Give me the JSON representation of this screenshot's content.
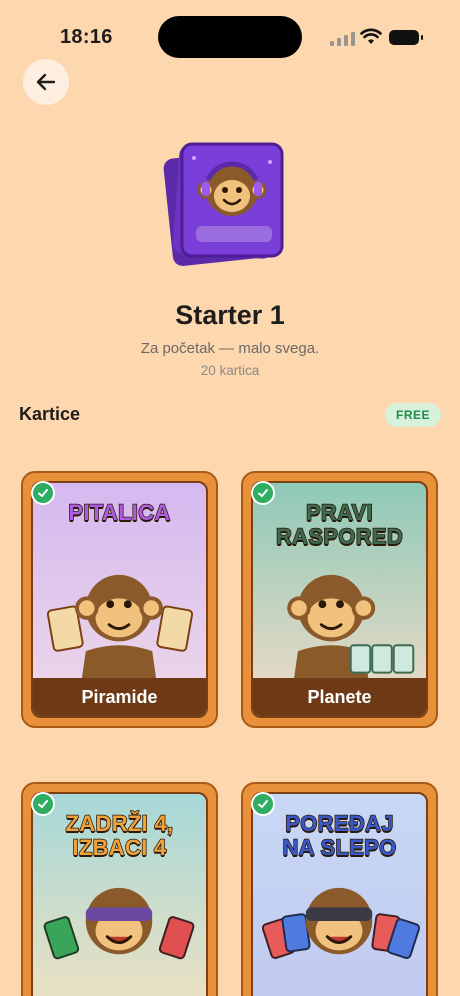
{
  "status_bar": {
    "time": "18:16"
  },
  "deck": {
    "title": "Starter 1",
    "subtitle": "Za početak — malo svega.",
    "count": "20 kartica"
  },
  "section": {
    "label": "Kartice",
    "badge": "FREE"
  },
  "cards": [
    {
      "title": "PITALICA",
      "footer": "Piramide",
      "title_color": "#b05ce0",
      "bg_top": "#d5b8f0",
      "bg_bottom": "#f0d9e8"
    },
    {
      "title": "PRAVI\nRASPORED",
      "footer": "Planete",
      "title_color": "#3f6a52",
      "bg_top": "#8fc9b8",
      "bg_bottom": "#f2dcc8"
    },
    {
      "title": "ZADRŽI 4,\nIZBACI 4",
      "footer": "",
      "title_color": "#f2a23a",
      "bg_top": "#a6d8d8",
      "bg_bottom": "#f3e2c0"
    },
    {
      "title": "POREĐAJ\nNA SLEPO",
      "footer": "",
      "title_color": "#3a58c8",
      "bg_top": "#c8d8f4",
      "bg_bottom": "#c0c8f0"
    }
  ],
  "colors": {
    "background": "#fdd7ad",
    "card_frame": "#e9913a",
    "check": "#2fae63"
  },
  "icons": {
    "back": "arrow-left-icon",
    "check": "check-circle-icon"
  }
}
